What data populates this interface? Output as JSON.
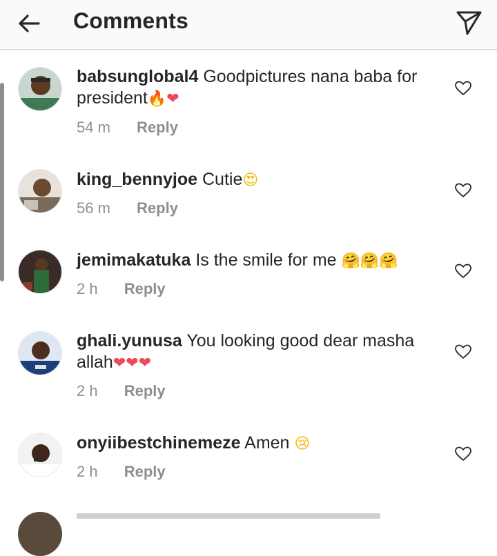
{
  "header": {
    "title": "Comments",
    "back_icon": "arrow-left-icon",
    "share_icon": "paper-plane-icon"
  },
  "reply_label": "Reply",
  "comments": [
    {
      "username": "babsunglobal4",
      "text": "Goodpictures nana baba for president",
      "emojis": "🔥❤",
      "time": "54 m"
    },
    {
      "username": "king_bennyjoe",
      "text": "Cutie",
      "emojis": "😍",
      "time": "56 m"
    },
    {
      "username": "jemimakatuka",
      "text": "Is the smile for me",
      "emojis": "🤗🤗🤗",
      "time": "2 h"
    },
    {
      "username": "ghali.yunusa",
      "text": "You looking good dear masha allah",
      "emojis": "❤❤❤",
      "time": "2 h"
    },
    {
      "username": "onyiibestchinemeze",
      "text": "Amen",
      "emojis": "😢",
      "time": "2 h"
    }
  ],
  "colors": {
    "header_bg": "#fafafa",
    "text": "#262626",
    "muted": "#8e8e8e",
    "heart_red": "#ed4956"
  }
}
